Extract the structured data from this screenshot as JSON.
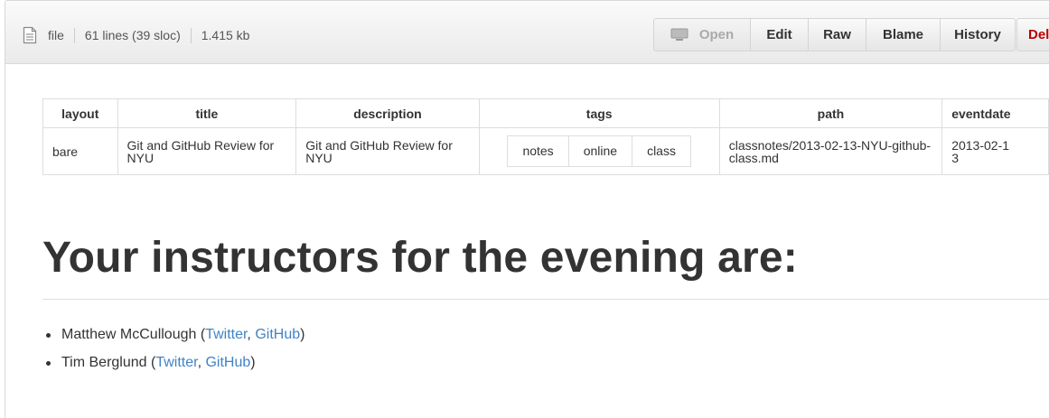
{
  "filebar": {
    "mode": "file",
    "lines": "61 lines (39 sloc)",
    "size": "1.415 kb",
    "buttons": {
      "open": "Open",
      "edit": "Edit",
      "raw": "Raw",
      "blame": "Blame",
      "history": "History",
      "delete": "Delete"
    }
  },
  "frontmatter": {
    "headers": {
      "layout": "layout",
      "title": "title",
      "description": "description",
      "tags": "tags",
      "path": "path",
      "eventdate": "eventdate"
    },
    "row": {
      "layout": "bare",
      "title": "Git and GitHub Review for NYU",
      "description": "Git and GitHub Review for NYU",
      "tags": [
        "notes",
        "online",
        "class"
      ],
      "path": "classnotes/2013-02-13-NYU-github-class.md",
      "eventdate": "2013-02-13"
    }
  },
  "heading": "Your instructors for the evening are:",
  "instructors": [
    {
      "name": "Matthew McCullough",
      "twitter": "Twitter",
      "github": "GitHub"
    },
    {
      "name": "Tim Berglund",
      "twitter": "Twitter",
      "github": "GitHub"
    }
  ],
  "punct": {
    "open": " (",
    "comma": ", ",
    "close": ")"
  },
  "colors": {
    "link": "#4183c4",
    "delete": "#bb0000"
  },
  "icons": {
    "file": "file-text-icon",
    "open": "monitor-icon"
  }
}
